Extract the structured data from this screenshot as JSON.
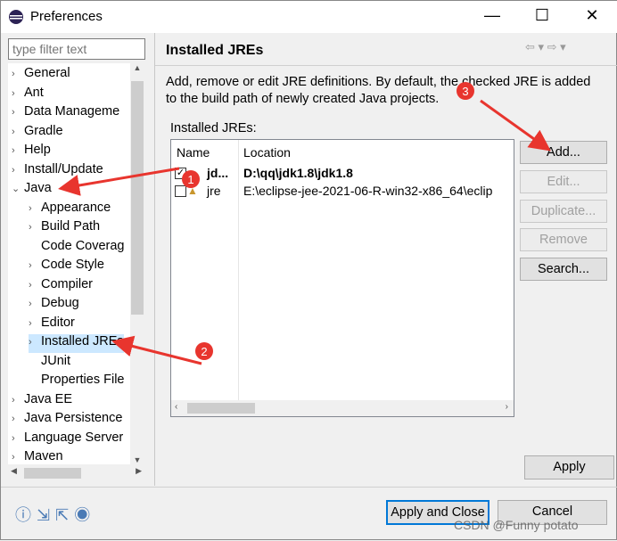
{
  "window": {
    "title": "Preferences",
    "minimize": "—",
    "maximize": "☐",
    "close": "✕"
  },
  "filter": {
    "placeholder": "type filter text"
  },
  "tree": [
    {
      "label": "General",
      "level": 0,
      "expander": "›"
    },
    {
      "label": "Ant",
      "level": 0,
      "expander": "›"
    },
    {
      "label": "Data Manageme",
      "level": 0,
      "expander": "›"
    },
    {
      "label": "Gradle",
      "level": 0,
      "expander": "›"
    },
    {
      "label": "Help",
      "level": 0,
      "expander": "›"
    },
    {
      "label": "Install/Update",
      "level": 0,
      "expander": "›"
    },
    {
      "label": "Java",
      "level": 0,
      "expander": "⌄"
    },
    {
      "label": "Appearance",
      "level": 1,
      "expander": "›"
    },
    {
      "label": "Build Path",
      "level": 1,
      "expander": "›"
    },
    {
      "label": "Code Coverag",
      "level": 1,
      "expander": ""
    },
    {
      "label": "Code Style",
      "level": 1,
      "expander": "›"
    },
    {
      "label": "Compiler",
      "level": 1,
      "expander": "›"
    },
    {
      "label": "Debug",
      "level": 1,
      "expander": "›"
    },
    {
      "label": "Editor",
      "level": 1,
      "expander": "›"
    },
    {
      "label": "Installed JREs",
      "level": 1,
      "expander": "›",
      "selected": true
    },
    {
      "label": "JUnit",
      "level": 1,
      "expander": ""
    },
    {
      "label": "Properties File",
      "level": 1,
      "expander": ""
    },
    {
      "label": "Java EE",
      "level": 0,
      "expander": "›"
    },
    {
      "label": "Java Persistence",
      "level": 0,
      "expander": "›"
    },
    {
      "label": "Language Server",
      "level": 0,
      "expander": "›"
    },
    {
      "label": "Maven",
      "level": 0,
      "expander": "›"
    }
  ],
  "page": {
    "title": "Installed JREs",
    "description_1": "Add, remove or edit JRE definitions. By default, the checked JRE is added",
    "description_2": "to the build path of newly created Java projects.",
    "list_label": "Installed JREs:"
  },
  "table": {
    "columns": [
      "Name",
      "Location"
    ],
    "rows": [
      {
        "name": "jd...",
        "location": "D:\\qq\\jdk1.8\\jdk1.8",
        "checked": true,
        "bold": true
      },
      {
        "name": "jre",
        "location": "E:\\eclipse-jee-2021-06-R-win32-x86_64\\eclip",
        "checked": false,
        "bold": false
      }
    ]
  },
  "buttons": {
    "add": "Add...",
    "edit": "Edit...",
    "duplicate": "Duplicate...",
    "remove": "Remove",
    "search": "Search...",
    "apply": "Apply",
    "apply_close": "Apply and Close",
    "cancel": "Cancel"
  },
  "annotations": [
    "1",
    "2",
    "3"
  ],
  "watermark": "CSDN @Funny potato",
  "colors": {
    "accent": "#0078d7",
    "arrow": "#e8352e",
    "selection": "#cce8ff"
  }
}
